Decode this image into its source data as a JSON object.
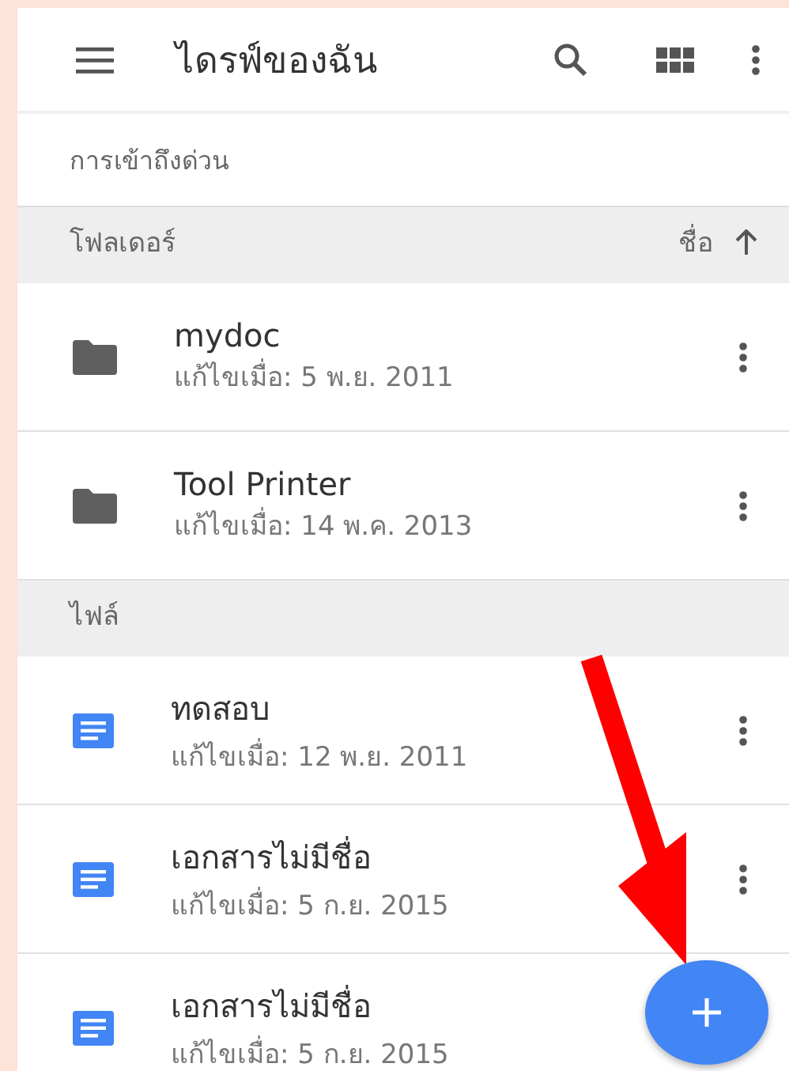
{
  "app_bar": {
    "title": "ไดรฟ์ของฉัน"
  },
  "quick_access": {
    "label": "การเข้าถึงด่วน"
  },
  "sections": [
    {
      "title": "โฟลเดอร์",
      "sort_label": "ชื่อ",
      "items": [
        {
          "kind": "folder",
          "name": "mydoc",
          "modified": "แก้ไขเมื่อ: 5 พ.ย. 2011"
        },
        {
          "kind": "folder",
          "name": "Tool Printer",
          "modified": "แก้ไขเมื่อ: 14 พ.ค. 2013"
        }
      ]
    },
    {
      "title": "ไฟล์",
      "items": [
        {
          "kind": "doc",
          "name": "ทดสอบ",
          "modified": "แก้ไขเมื่อ: 12 พ.ย. 2011"
        },
        {
          "kind": "doc",
          "name": "เอกสารไม่มีชื่อ",
          "modified": "แก้ไขเมื่อ: 5 ก.ย. 2015"
        },
        {
          "kind": "doc",
          "name": "เอกสารไม่มีชื่อ",
          "modified": "แก้ไขเมื่อ: 5 ก.ย. 2015"
        }
      ]
    }
  ]
}
